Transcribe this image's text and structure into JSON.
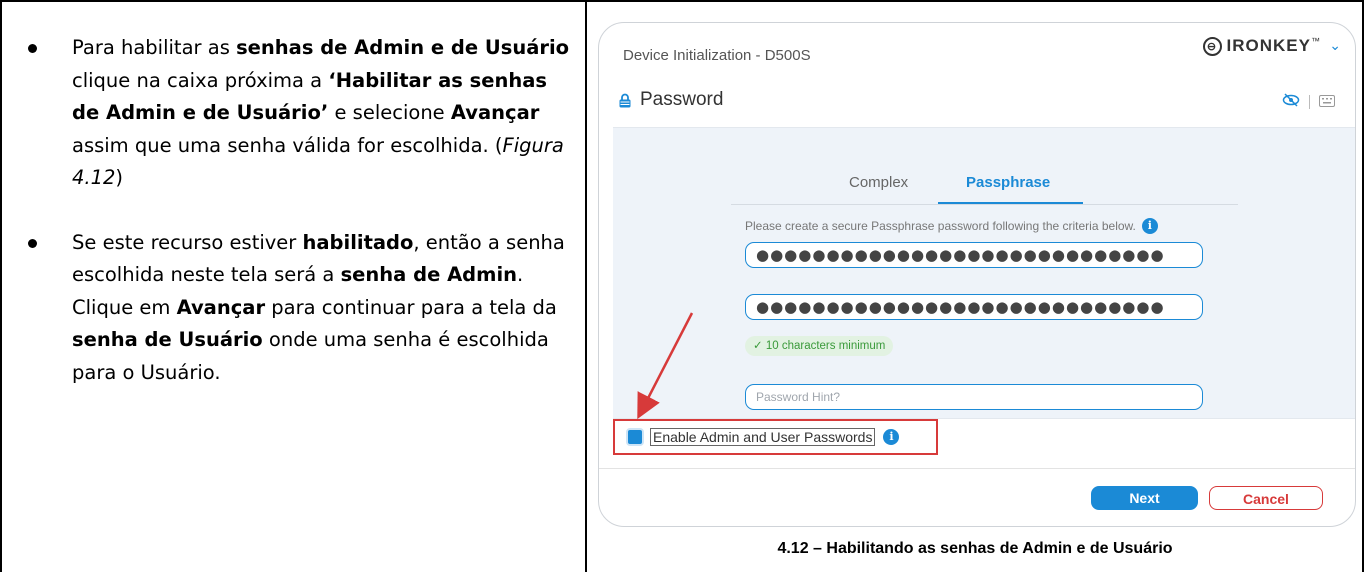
{
  "doc": {
    "bullet1": {
      "t1": "Para habilitar as ",
      "b1": "senhas de Admin e de Usuário",
      "t2": " clique na caixa próxima a ",
      "b2": "‘Habilitar as senhas de Admin e de Usuário’",
      "t3": " e selecione ",
      "b3": "Avançar",
      "t4": " assim que uma senha válida for escolhida. (",
      "i1": "Figura 4.12",
      "t5": ")"
    },
    "bullet2": {
      "t1": "Se este recurso estiver ",
      "b1": "habilitado",
      "t2": ", então a senha escolhida neste tela será a ",
      "b2": "senha de Admin",
      "t3": ". Clique em ",
      "b3": "Avançar",
      "t4": " para continuar para a tela da ",
      "b4": "senha de Usuário",
      "t5": " onde uma senha é escolhida para o Usuário."
    },
    "caption": "4.12 – Habilitando as senhas de Admin e de Usuário"
  },
  "app": {
    "window_title": "Device Initialization - D500S",
    "brand": "IRONKEY",
    "brand_mark": "™",
    "section_title": "Password",
    "tabs": [
      "Complex",
      "Passphrase"
    ],
    "active_tab": "Passphrase",
    "criteria_text": "Please create a secure Passphrase password following the criteria below.",
    "password_value": "●●●●●●●●●●●●●●●●●●●●●●●●●●●●●",
    "confirm_value": "●●●●●●●●●●●●●●●●●●●●●●●●●●●●●",
    "min_badge": "✓ 10 characters minimum",
    "hint_placeholder": "Password Hint?",
    "enable_label": "Enable Admin and User Passwords",
    "enable_checked": true,
    "next_label": "Next",
    "cancel_label": "Cancel",
    "info_glyph": "i"
  },
  "colors": {
    "accent": "#1b8ad6",
    "highlight": "#d73a3a"
  }
}
